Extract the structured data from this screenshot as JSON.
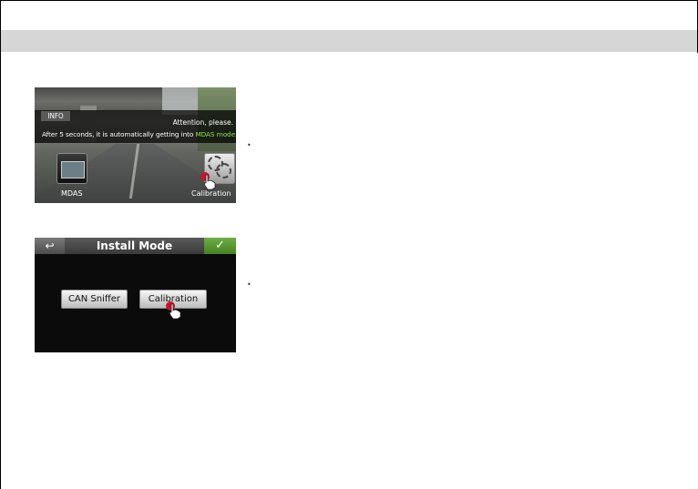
{
  "screen1": {
    "info_tab": "INFO",
    "attention": "Attention, please.",
    "message_prefix": "After 5 seconds, it is automatically getting into",
    "message_highlight": "MDAS mode.",
    "apps": [
      {
        "label": "MDAS",
        "icon": "mdas-icon"
      },
      {
        "label": "Calibration",
        "icon": "calibration-icon"
      }
    ],
    "highlight_color": "#8fe04a"
  },
  "screen2": {
    "title": "Install Mode",
    "back_icon": "back-arrow-icon",
    "confirm_icon": "check-icon",
    "buttons": [
      {
        "label": "CAN Sniffer"
      },
      {
        "label": "Calibration"
      }
    ],
    "confirm_color": "#5a9a33"
  },
  "bullets": [
    "•",
    "•"
  ]
}
